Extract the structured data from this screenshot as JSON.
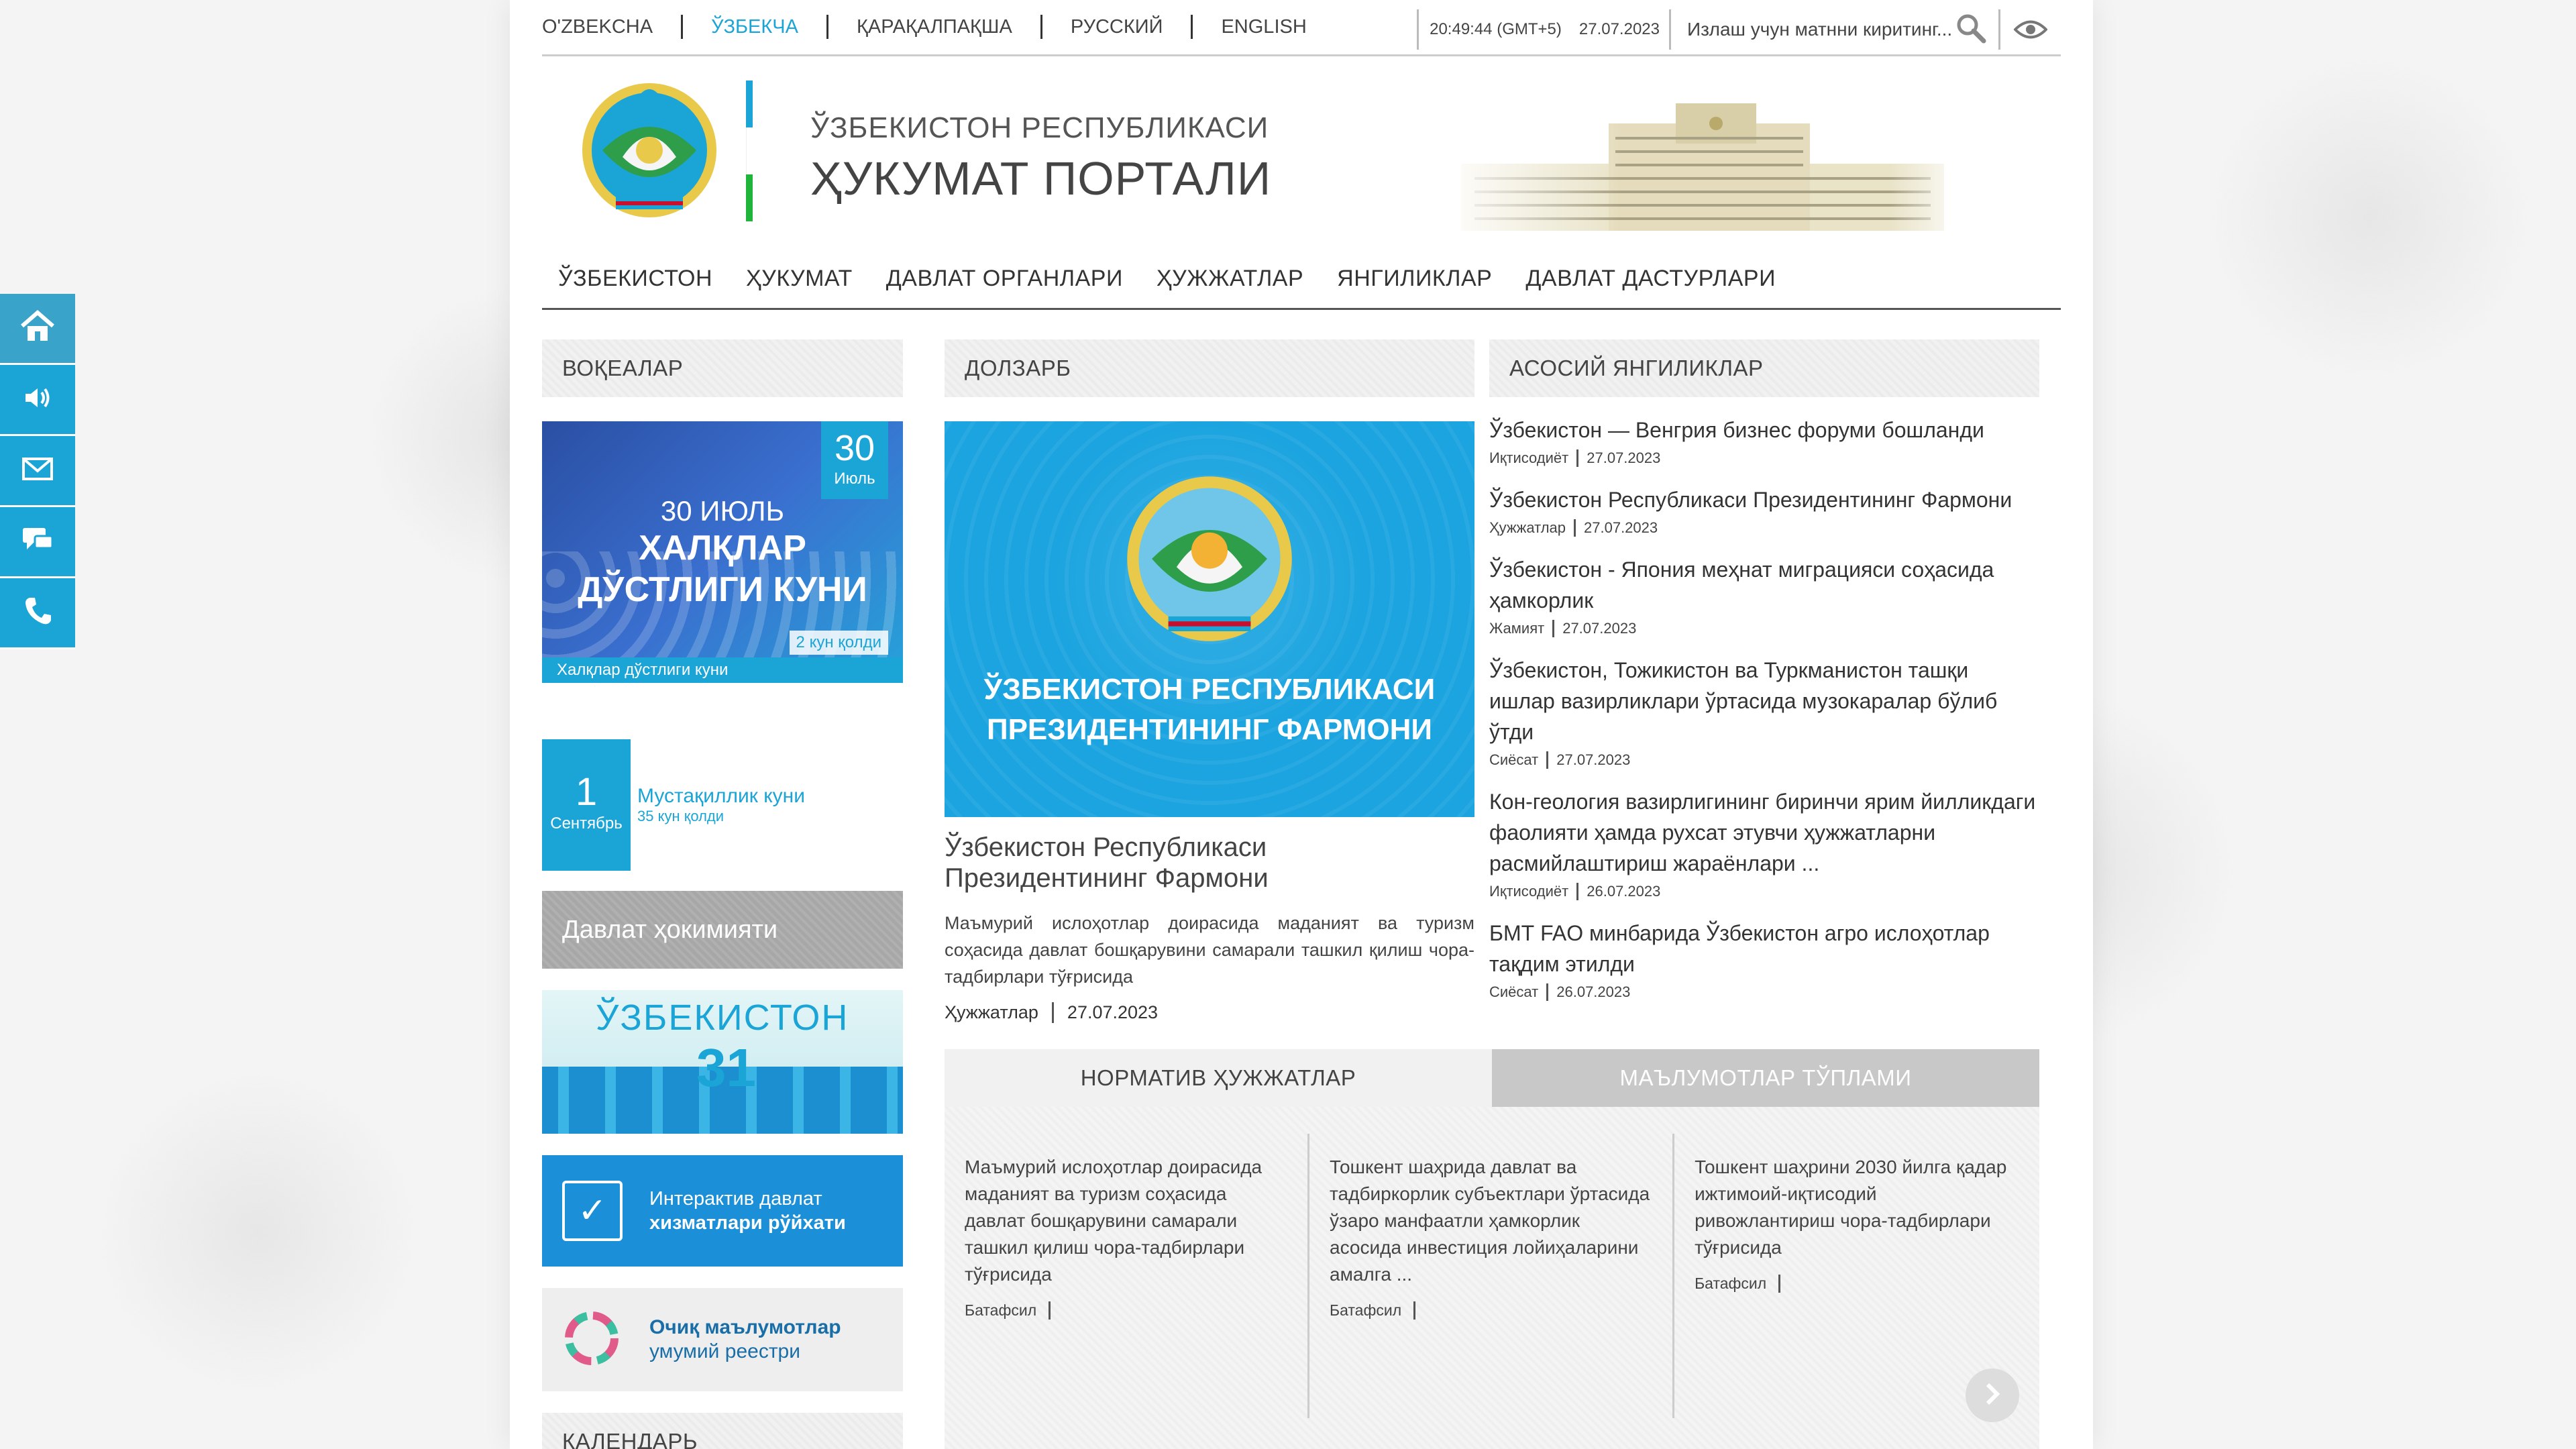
{
  "languages": [
    {
      "label": "O'ZBEKCHA",
      "active": false
    },
    {
      "label": "ЎЗБЕКЧА",
      "active": true
    },
    {
      "label": "ҚАРАҚАЛПАҚША",
      "active": false
    },
    {
      "label": "РУССКИЙ",
      "active": false
    },
    {
      "label": "ENGLISH",
      "active": false
    }
  ],
  "topbar": {
    "time": "20:49:44 (GMT+5)",
    "date": "27.07.2023",
    "search_placeholder": "Излаш учун матнни киритинг..."
  },
  "header": {
    "subtitle": "ЎЗБЕКИСТОН РЕСПУБЛИКАСИ",
    "title": "ҲУКУМАТ ПОРТАЛИ"
  },
  "nav": [
    "ЎЗБЕКИСТОН",
    "ҲУКУМАТ",
    "ДАВЛАТ ОРГАНЛАРИ",
    "ҲУЖЖАТЛАР",
    "ЯНГИЛИКЛАР",
    "ДАВЛАТ ДАСТУРЛАРИ"
  ],
  "sidetools": [
    "home-icon",
    "speaker-icon",
    "mail-icon",
    "chat-icon",
    "phone-icon"
  ],
  "events": {
    "heading": "ВОҚЕАЛАР",
    "banner": {
      "day": "30",
      "month": "Июль",
      "line1": "30 ИЮЛЬ",
      "line2": "ХАЛҚЛАР",
      "line3": "ДЎСТЛИГИ КУНИ",
      "days_left": "2 кун қолди",
      "caption": "Халқлар дўстлиги куни"
    },
    "next": {
      "day": "1",
      "month": "Сентябрь",
      "name": "Мустақиллик куни",
      "days_left": "35 кун қолди"
    }
  },
  "gov_banner": "Давлат ҳокимияти",
  "uz31": {
    "title": "ЎЗБЕКИСТОН",
    "number": "31"
  },
  "services": {
    "line1": "Интерактив давлат",
    "line2": "хизматлари рўйхати"
  },
  "opendata": {
    "line1": "Очиқ маълумотлар",
    "line2": "умумий реестри"
  },
  "calendar_heading": "КАЛЕНДАРЬ",
  "featured": {
    "heading": "ДОЛЗАРБ",
    "image_caption_1": "ЎЗБЕКИСТОН РЕСПУБЛИКАСИ",
    "image_caption_2": "ПРЕЗИДЕНТИНИНГ ФАРМОНИ",
    "title": "Ўзбекистон Республикаси Президентининг Фармони",
    "description": "Маъмурий ислоҳотлар доирасида маданият ва туризм соҳасида давлат бошқарувини самарали ташкил қилиш чора-тадбирлари тўғрисида",
    "category": "Ҳужжатлар",
    "date": "27.07.2023"
  },
  "news": {
    "heading": "АСОСИЙ ЯНГИЛИКЛАР",
    "items": [
      {
        "title": "Ўзбекистон — Венгрия бизнес форуми бошланди",
        "category": "Иқтисодиёт",
        "date": "27.07.2023"
      },
      {
        "title": "Ўзбекистон Республикаси Президентининг Фармони",
        "category": "Ҳужжатлар",
        "date": "27.07.2023"
      },
      {
        "title": "Ўзбекистон - Япония меҳнат миграцияси соҳасида ҳамкорлик",
        "category": "Жамият",
        "date": "27.07.2023"
      },
      {
        "title": "Ўзбекистон, Тожикистон ва Туркманистон ташқи ишлар вазирликлари ўртасида музокаралар бўлиб ўтди",
        "category": "Сиёсат",
        "date": "27.07.2023"
      },
      {
        "title": "Кон-геология вазирлигининг биринчи ярим йилликдаги фаолияти ҳамда рухсат этувчи ҳужжатларни расмийлаштириш жараёнлари ...",
        "category": "Иқтисодиёт",
        "date": "26.07.2023"
      },
      {
        "title": "БМТ FAO минбарида Ўзбекистон агро ислоҳотлар тақдим этилди",
        "category": "Сиёсат",
        "date": "26.07.2023"
      }
    ]
  },
  "docs": {
    "tabs": [
      "НОРМАТИВ ҲУЖЖАТЛАР",
      "МАЪЛУМОТЛАР ТЎПЛАМИ"
    ],
    "more_label": "Батафсил",
    "items": [
      {
        "title": "Маъмурий ислоҳотлар доирасида маданият ва туризм соҳасида давлат бошқарувини самарали ташкил қилиш чора-тадбирлари тўғрисида"
      },
      {
        "title": "Тошкент шаҳрида давлат ва тадбиркорлик субъектлари ўртасида ўзаро манфаатли ҳамкорлик асосида инвестиция лойиҳаларини амалга ..."
      },
      {
        "title": "Тошкент шаҳрини 2030 йилга қадар ижтимоий-иқтисодий ривожлантириш чора-тадбирлари тўғрисида"
      }
    ]
  },
  "colors": {
    "accent": "#1ba4d6",
    "text": "#333333",
    "flag_blue": "#1ba4d6",
    "flag_red": "#c8102e",
    "flag_green": "#1eb53a"
  }
}
